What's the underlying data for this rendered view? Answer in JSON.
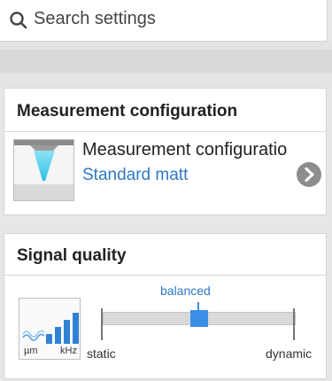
{
  "search": {
    "placeholder": "Search settings",
    "icon": "magnifier-icon"
  },
  "measurement_section": {
    "title": "Measurement configuration",
    "item": {
      "title": "Measurement configuratio",
      "subtitle": "Standard matt",
      "icon": "sensor-beam-icon",
      "action_icon": "chevron-right-circle-icon"
    }
  },
  "signal_section": {
    "title": "Signal quality",
    "icon": {
      "name": "signal-bars-icon",
      "unit_left": "µm",
      "unit_right": "kHz"
    },
    "slider": {
      "current_label": "balanced",
      "left_label": "static",
      "right_label": "dynamic",
      "value_fraction": 0.5
    }
  },
  "colors": {
    "accent": "#2f78c4",
    "handle": "#3a8ee6",
    "chevron_bg": "#8d8d8d"
  }
}
